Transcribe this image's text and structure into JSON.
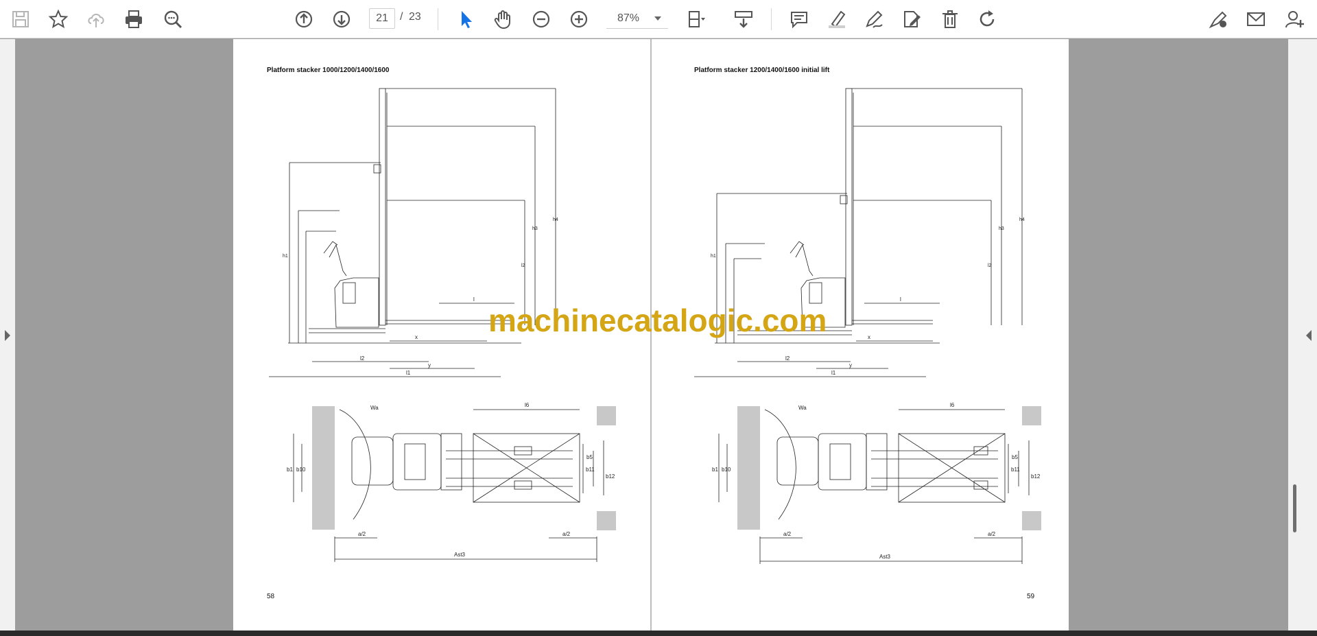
{
  "toolbar": {
    "page_current": "21",
    "page_separator": "/",
    "page_total": "23",
    "zoom": "87%",
    "icons": [
      "save-icon",
      "star-icon",
      "upload-cloud-icon",
      "print-icon",
      "zoom-search-icon",
      "arrow-up-circle-icon",
      "arrow-down-circle-icon",
      "pointer-icon",
      "hand-icon",
      "zoom-out-icon",
      "zoom-in-icon",
      "fit-page-icon",
      "scroll-mode-icon",
      "comment-icon",
      "highlight-icon",
      "draw-icon",
      "edit-text-icon",
      "delete-icon",
      "rotate-icon",
      "sign-icon",
      "email-icon",
      "add-user-icon"
    ],
    "accent": "#1473e6"
  },
  "pages": {
    "left": {
      "title": "Platform stacker 1000/1200/1400/1600",
      "page_number": "58",
      "labels": {
        "h1": "h1",
        "h3": "h3",
        "h4": "h4",
        "l2": "l2",
        "l1": "l1",
        "x": "x",
        "y": "y",
        "l6": "l6",
        "Wa": "Wa",
        "b1": "b1",
        "b10": "b10",
        "b11": "b11",
        "b5": "b5",
        "b12": "b12",
        "a2": "a/2",
        "Ast3": "Ast3",
        "l": "l"
      }
    },
    "right": {
      "title": "Platform stacker 1200/1400/1600 initial lift",
      "page_number": "59",
      "labels": {
        "h1": "h1",
        "h3": "h3",
        "h4": "h4",
        "l2": "l2",
        "l1": "l1",
        "x": "x",
        "y": "y",
        "l6": "l6",
        "Wa": "Wa",
        "b1": "b1",
        "b10": "b10",
        "b11": "b11",
        "b5": "b5",
        "b12": "b12",
        "a2": "a/2",
        "Ast3": "Ast3",
        "l": "l"
      }
    }
  },
  "watermark": "machinecatalogic.com"
}
